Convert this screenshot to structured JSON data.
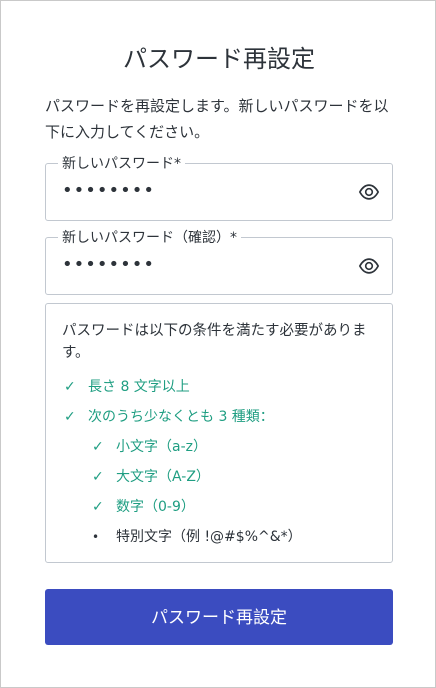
{
  "page": {
    "title": "パスワード再設定",
    "description": "パスワードを再設定します。新しいパスワードを以下に入力してください。"
  },
  "fields": [
    {
      "label": "新しいパスワード*",
      "value": "••••••••",
      "icon": "eye-icon"
    },
    {
      "label": "新しいパスワード（確認）*",
      "value": "••••••••",
      "icon": "eye-icon"
    }
  ],
  "requirements": {
    "heading": "パスワードは以下の条件を満たす必要があります。",
    "check_mark": "✓",
    "bullet_mark": "•",
    "items": [
      {
        "text": "長さ 8 文字以上",
        "met": true
      },
      {
        "text": "次のうち少なくとも 3 種類：",
        "met": true
      },
      {
        "text": "小文字（a-z）",
        "met": true
      },
      {
        "text": "大文字（A-Z）",
        "met": true
      },
      {
        "text": "数字（0-9）",
        "met": true
      },
      {
        "text": "特別文字（例 !@#$%^&*）",
        "met": false
      }
    ],
    "met_color": "#1f9e82"
  },
  "submit": {
    "label": "パスワード再設定",
    "color": "#3b4cc0"
  }
}
